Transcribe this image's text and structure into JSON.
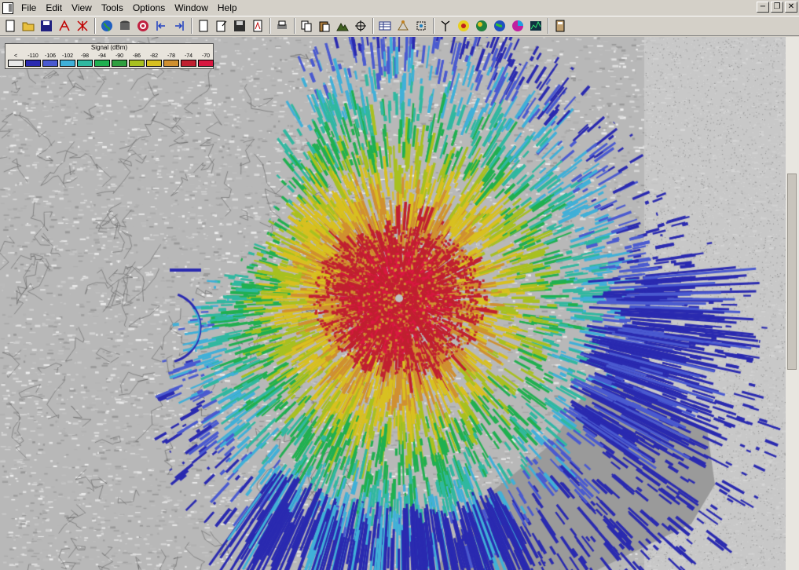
{
  "menubar": {
    "items": [
      {
        "label": "File",
        "name": "menu-file"
      },
      {
        "label": "Edit",
        "name": "menu-edit"
      },
      {
        "label": "View",
        "name": "menu-view"
      },
      {
        "label": "Tools",
        "name": "menu-tools"
      },
      {
        "label": "Options",
        "name": "menu-options"
      },
      {
        "label": "Window",
        "name": "menu-window"
      },
      {
        "label": "Help",
        "name": "menu-help"
      }
    ]
  },
  "window_controls": [
    "minimize-button",
    "restore-button",
    "close-button"
  ],
  "toolbar": {
    "groups": [
      [
        "new-file-icon",
        "open-folder-icon",
        "save-icon",
        "draw-path-icon",
        "erase-path-icon"
      ],
      [
        "globe-icon",
        "database-icon",
        "target-icon",
        "step-back-icon",
        "step-forward-icon"
      ],
      [
        "page-icon",
        "page-edit-icon",
        "disk-icon",
        "pdf-icon"
      ],
      [
        "print-icon"
      ],
      [
        "copy-icon",
        "paste-icon",
        "terrain-icon",
        "crosshair-icon"
      ],
      [
        "table-icon",
        "network-icon",
        "zoom-extents-icon"
      ],
      [
        "antenna-icon",
        "coverage-icon",
        "globe-green-icon",
        "globe-region-icon",
        "pie-icon",
        "spectrum-icon"
      ],
      [
        "calculator-icon"
      ]
    ]
  },
  "legend": {
    "title": "Signal (dBm)",
    "labels": [
      "<",
      "-110",
      "-106",
      "-102",
      "-98",
      "-94",
      "-90",
      "-86",
      "-82",
      "-78",
      "-74",
      "-70"
    ],
    "colors": [
      "#e8e8e8",
      "#2a2ab0",
      "#4a5ad0",
      "#40b0d8",
      "#30b8a0",
      "#20b050",
      "#30a040",
      "#a8c020",
      "#d8c020",
      "#d09030",
      "#c02030",
      "#d81840"
    ]
  },
  "map": {
    "terrain_color": "#b8b8b8",
    "water_color": "#9a9a9a",
    "site_marker_color": "#c0c0c0"
  }
}
